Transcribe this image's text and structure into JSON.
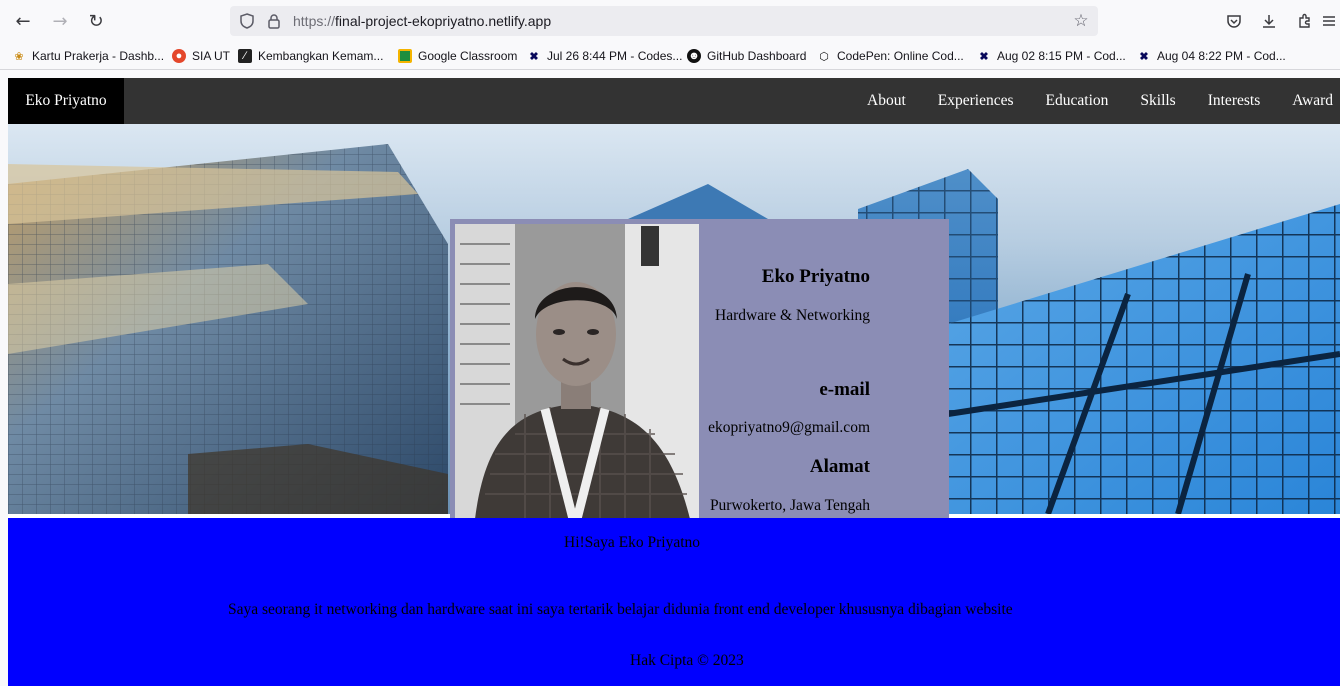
{
  "browser": {
    "url_scheme": "https://",
    "url_host": "final-project-ekopriyatno.netlify.app",
    "bookmarks": [
      "Kartu Prakerja - Dashb...",
      "SIA UT",
      "Kembangkan Kemam...",
      "Google Classroom",
      "Jul 26 8:44 PM - Codes...",
      "GitHub Dashboard",
      "CodePen: Online Cod...",
      "Aug 02 8:15 PM - Cod...",
      "Aug 04 8:22 PM - Cod..."
    ]
  },
  "site": {
    "brand": "Eko Priyatno",
    "nav": [
      "About",
      "Experiences",
      "Education",
      "Skills",
      "Interests",
      "Award"
    ]
  },
  "profile": {
    "name": "Eko Priyatno",
    "role": "Hardware & Networking",
    "email_heading": "e-mail",
    "email": "ekopriyatno9@gmail.com",
    "address_heading": "Alamat",
    "address": "Purwokerto, Jawa Tengah"
  },
  "about": {
    "greeting": "Hi!Saya Eko Priyatno",
    "description": "Saya seorang it networking dan hardware saat ini saya tertarik belajar didunia front end developer khususnya dibagian website",
    "copyright": "Hak Cipta © 2023"
  },
  "colors": {
    "nav_bg": "#333333",
    "brand_bg": "#000000",
    "card_bg": "#8b8db5",
    "about_bg": "#0000ff"
  }
}
